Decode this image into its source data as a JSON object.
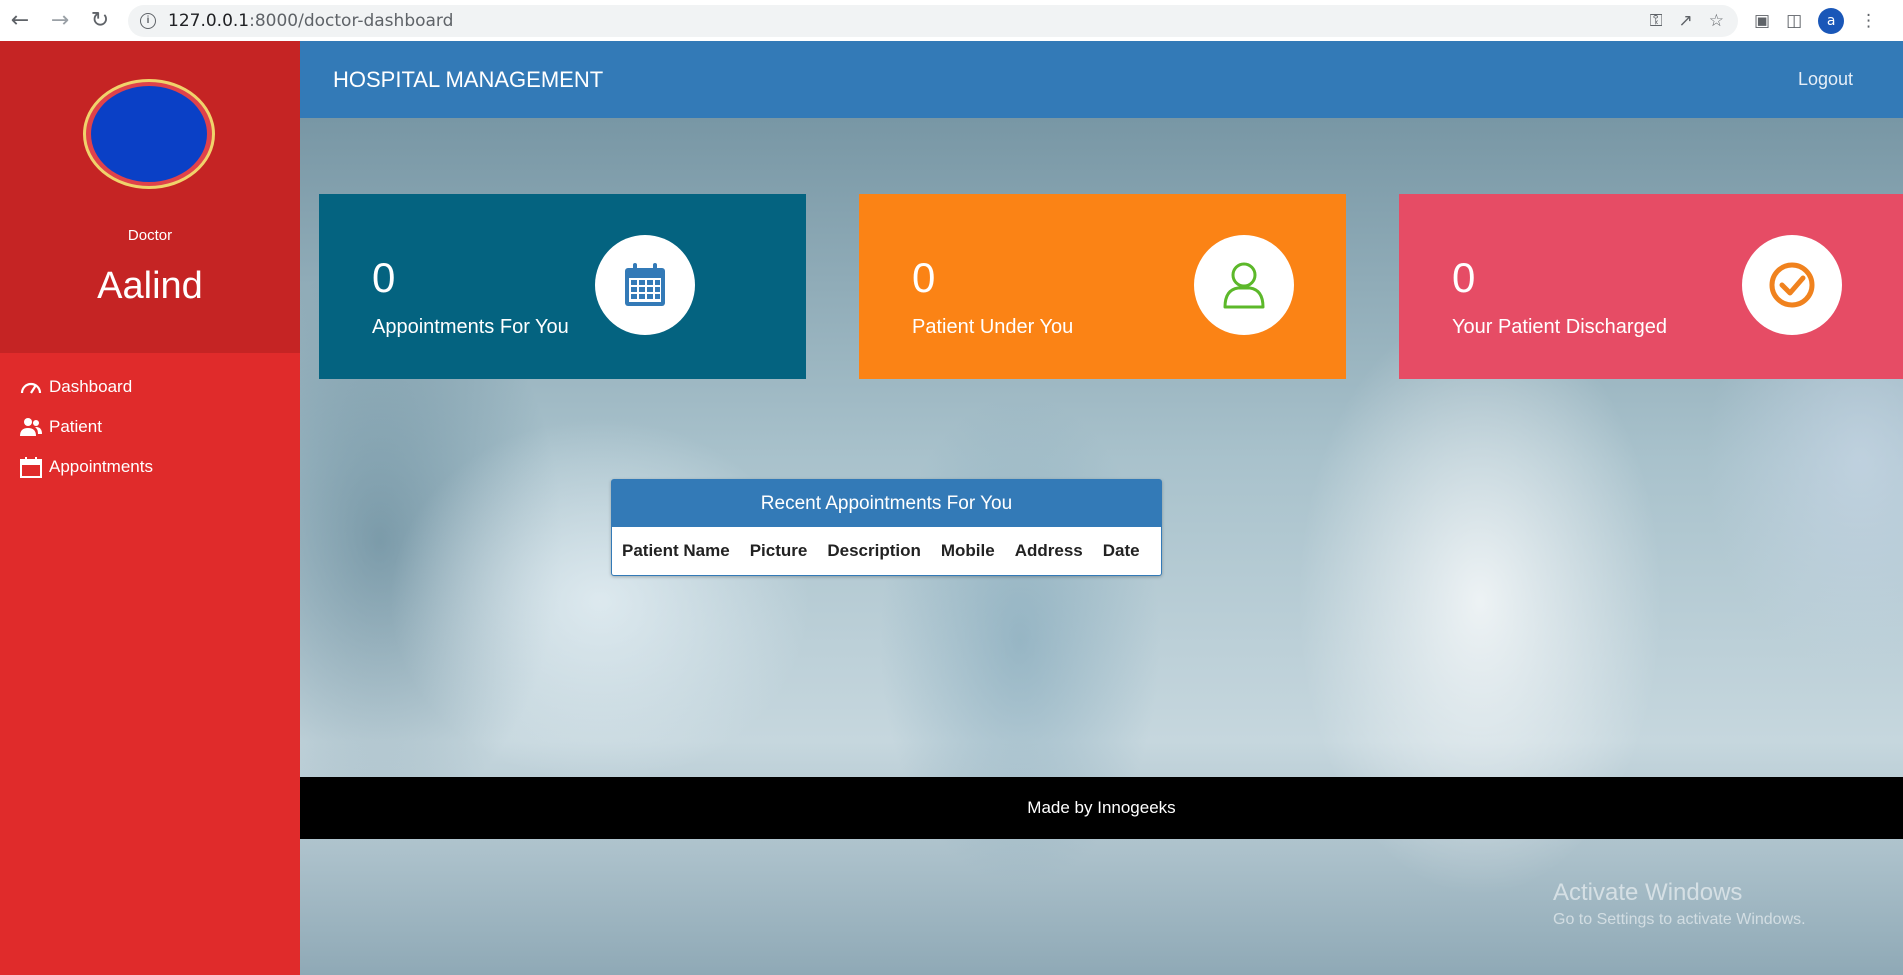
{
  "browser": {
    "url_host": "127.0.0.1",
    "url_port": ":8000",
    "url_path": "/doctor-dashboard",
    "profile_initial": "a"
  },
  "sidebar": {
    "role": "Doctor",
    "name": "Aalind",
    "items": [
      {
        "label": "Dashboard",
        "icon": "speedometer-icon"
      },
      {
        "label": "Patient",
        "icon": "users-icon"
      },
      {
        "label": "Appointments",
        "icon": "calendar-icon"
      }
    ]
  },
  "header": {
    "brand": "HOSPITAL MANAGEMENT",
    "logout": "Logout"
  },
  "cards": [
    {
      "count": "0",
      "label": "Appointments For You",
      "icon": "calendar-icon",
      "color": "#046380"
    },
    {
      "count": "0",
      "label": "Patient Under You",
      "icon": "user-icon",
      "color": "#fb8315"
    },
    {
      "count": "0",
      "label": "Your Patient Discharged",
      "icon": "check-circle-icon",
      "color": "#e64c65"
    }
  ],
  "appointments": {
    "heading": "Recent Appointments For You",
    "columns": [
      "Patient Name",
      "Picture",
      "Description",
      "Mobile",
      "Address",
      "Date"
    ]
  },
  "footer": {
    "text": "Made by Innogeeks"
  },
  "watermark": {
    "title": "Activate Windows",
    "subtitle": "Go to Settings to activate Windows."
  }
}
